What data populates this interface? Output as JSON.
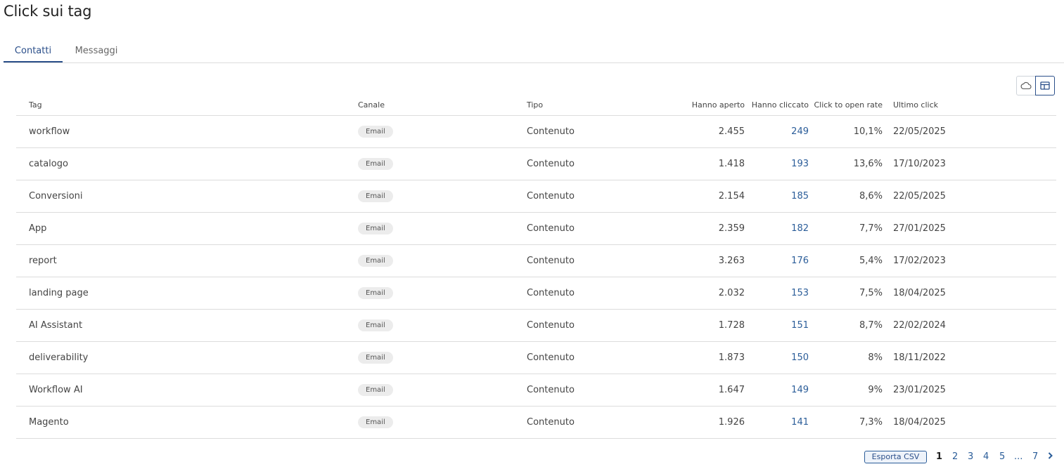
{
  "page": {
    "title": "Click sui tag"
  },
  "tabs": [
    {
      "label": "Contatti",
      "active": true
    },
    {
      "label": "Messaggi",
      "active": false
    }
  ],
  "view_toggle": {
    "icons": [
      "cloud-icon",
      "table-icon"
    ],
    "active": "table-icon",
    "accent": "#2b4f8a"
  },
  "table": {
    "columns": [
      "Tag",
      "Canale",
      "Tipo",
      "Hanno aperto",
      "Hanno cliccato",
      "Click to open rate",
      "Ultimo click"
    ],
    "rows": [
      {
        "tag": "workflow",
        "canale": "Email",
        "tipo": "Contenuto",
        "aperto": "2.455",
        "cliccato": "249",
        "rate": "10,1%",
        "ultimo": "22/05/2025"
      },
      {
        "tag": "catalogo",
        "canale": "Email",
        "tipo": "Contenuto",
        "aperto": "1.418",
        "cliccato": "193",
        "rate": "13,6%",
        "ultimo": "17/10/2023"
      },
      {
        "tag": "Conversioni",
        "canale": "Email",
        "tipo": "Contenuto",
        "aperto": "2.154",
        "cliccato": "185",
        "rate": "8,6%",
        "ultimo": "22/05/2025"
      },
      {
        "tag": "App",
        "canale": "Email",
        "tipo": "Contenuto",
        "aperto": "2.359",
        "cliccato": "182",
        "rate": "7,7%",
        "ultimo": "27/01/2025"
      },
      {
        "tag": "report",
        "canale": "Email",
        "tipo": "Contenuto",
        "aperto": "3.263",
        "cliccato": "176",
        "rate": "5,4%",
        "ultimo": "17/02/2023"
      },
      {
        "tag": "landing page",
        "canale": "Email",
        "tipo": "Contenuto",
        "aperto": "2.032",
        "cliccato": "153",
        "rate": "7,5%",
        "ultimo": "18/04/2025"
      },
      {
        "tag": "AI Assistant",
        "canale": "Email",
        "tipo": "Contenuto",
        "aperto": "1.728",
        "cliccato": "151",
        "rate": "8,7%",
        "ultimo": "22/02/2024"
      },
      {
        "tag": "deliverability",
        "canale": "Email",
        "tipo": "Contenuto",
        "aperto": "1.873",
        "cliccato": "150",
        "rate": "8%",
        "ultimo": "18/11/2022"
      },
      {
        "tag": "Workflow AI",
        "canale": "Email",
        "tipo": "Contenuto",
        "aperto": "1.647",
        "cliccato": "149",
        "rate": "9%",
        "ultimo": "23/01/2025"
      },
      {
        "tag": "Magento",
        "canale": "Email",
        "tipo": "Contenuto",
        "aperto": "1.926",
        "cliccato": "141",
        "rate": "7,3%",
        "ultimo": "18/04/2025"
      }
    ]
  },
  "footer": {
    "export_label": "Esporta CSV",
    "pages": [
      "1",
      "2",
      "3",
      "4",
      "5",
      "...",
      "7"
    ],
    "current_page": "1",
    "next_icon": "chevron-right-icon"
  }
}
